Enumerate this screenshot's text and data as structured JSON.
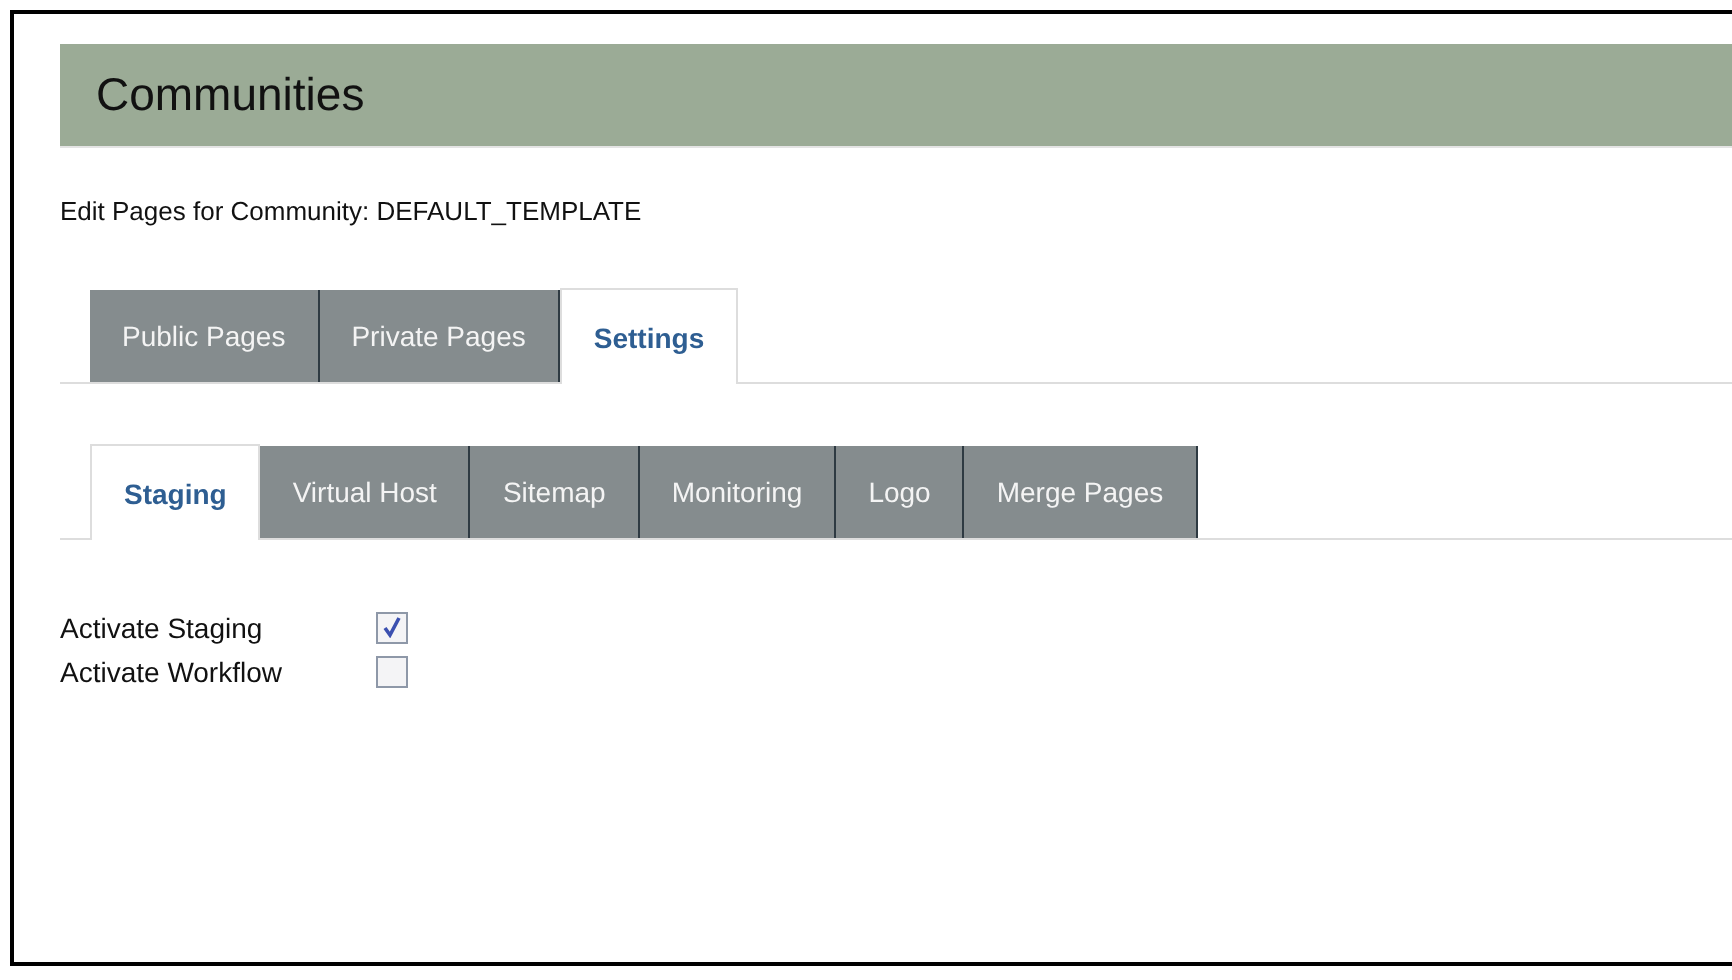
{
  "header": {
    "title": "Communities"
  },
  "subtitle": "Edit Pages for Community: DEFAULT_TEMPLATE",
  "tabs": [
    {
      "label": "Public Pages",
      "selected": false
    },
    {
      "label": "Private Pages",
      "selected": false
    },
    {
      "label": "Settings",
      "selected": true
    }
  ],
  "subtabs": [
    {
      "label": "Staging",
      "selected": true
    },
    {
      "label": "Virtual Host",
      "selected": false
    },
    {
      "label": "Sitemap",
      "selected": false
    },
    {
      "label": "Monitoring",
      "selected": false
    },
    {
      "label": "Logo",
      "selected": false
    },
    {
      "label": "Merge Pages",
      "selected": false
    }
  ],
  "options": [
    {
      "label": "Activate Staging",
      "checked": true
    },
    {
      "label": "Activate Workflow",
      "checked": false
    }
  ]
}
